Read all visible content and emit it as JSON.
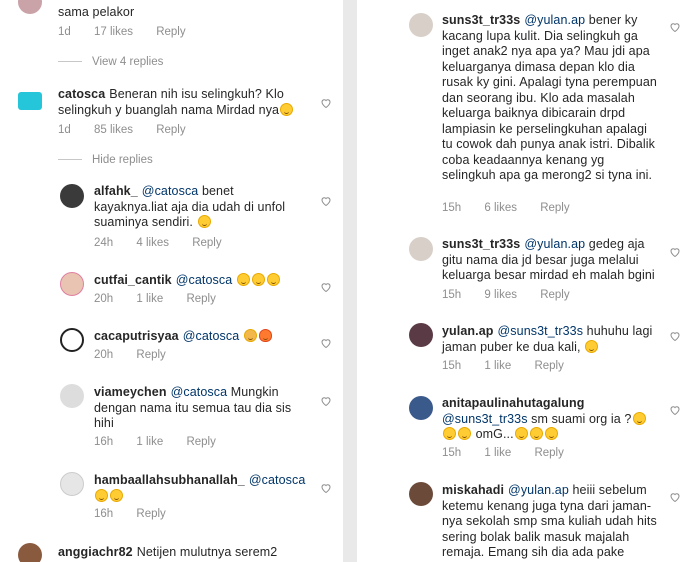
{
  "left": {
    "top_comment": {
      "text": "sama pelakor",
      "time": "1d",
      "likes": "17 likes",
      "reply": "Reply"
    },
    "view_replies": "View 4 replies",
    "main_comment": {
      "username": "catosca",
      "text": "Beneran nih isu selingkuh? Klo selingkuh y buanglah nama Mirdad nya",
      "time": "1d",
      "likes": "85 likes",
      "reply": "Reply"
    },
    "hide_replies": "Hide replies",
    "replies": [
      {
        "username": "alfahk_",
        "mention": "@catosca",
        "text": "benet kayaknya.liat aja dia udah di unfol suaminya sendiri.",
        "emoji_count": 1,
        "time": "24h",
        "likes": "4 likes",
        "reply": "Reply"
      },
      {
        "username": "cutfai_cantik",
        "mention": "@catosca",
        "text": "",
        "emoji_count": 3,
        "time": "20h",
        "likes": "1 like",
        "reply": "Reply"
      },
      {
        "username": "cacaputrisyaa",
        "mention": "@catosca",
        "text": "",
        "emoji_count": 2,
        "time": "20h",
        "likes": "",
        "reply": "Reply"
      },
      {
        "username": "viameychen",
        "mention": "@catosca",
        "text": "Mungkin dengan nama itu semua tau dia sis hihi",
        "emoji_count": 0,
        "time": "16h",
        "likes": "1 like",
        "reply": "Reply"
      },
      {
        "username": "hambaallahsubhanallah_",
        "mention": "@catosca",
        "text": "",
        "emoji_count": 2,
        "time": "16h",
        "likes": "",
        "reply": "Reply"
      }
    ],
    "bottom_comment": {
      "username": "anggiachr82",
      "text": "Netijen mulutnya serem2"
    }
  },
  "right": {
    "replies": [
      {
        "username": "suns3t_tr33s",
        "mention": "@yulan.ap",
        "text": "bener ky kacang lupa kulit. Dia selingkuh ga inget anak2 nya apa ya? Mau jdi apa keluarganya dimasa depan klo dia rusak ky gini. Apalagi tyna perempuan dan seorang ibu. Klo ada masalah keluarga baiknya dibicarain drpd lampiasin ke perselingkuhan apalagi tu cowok dah punya anak istri. Dibalik coba keadaannya kenang yg selingkuh apa ga merong2 si tyna ini.",
        "time": "15h",
        "likes": "6 likes",
        "reply": "Reply"
      },
      {
        "username": "suns3t_tr33s",
        "mention": "@yulan.ap",
        "text": "gedeg aja gitu nama dia jd besar juga melalui keluarga besar mirdad eh malah bgini",
        "time": "15h",
        "likes": "9 likes",
        "reply": "Reply"
      },
      {
        "username": "yulan.ap",
        "mention": "@suns3t_tr33s",
        "text": "huhuhu lagi jaman puber ke dua kali,",
        "time": "15h",
        "likes": "1 like",
        "reply": "Reply"
      },
      {
        "username": "anitapaulinahutagalung",
        "mention": "@suns3t_tr33s",
        "text": "sm suami org ia ?",
        "text2": "omG...",
        "time": "15h",
        "likes": "1 like",
        "reply": "Reply"
      },
      {
        "username": "miskahadi",
        "mention": "@yulan.ap",
        "text": "heiii sebelum ketemu kenang juga tyna dari jaman-nya sekolah smp sma kuliah udah hits sering bolak balik masuk majalah remaja. Emang sih dia ada pake nama"
      }
    ]
  },
  "icons": {
    "heart": "heart-outline-icon"
  },
  "colors": {
    "text": "#262626",
    "meta": "#8e8e8e",
    "mention": "#003569"
  }
}
